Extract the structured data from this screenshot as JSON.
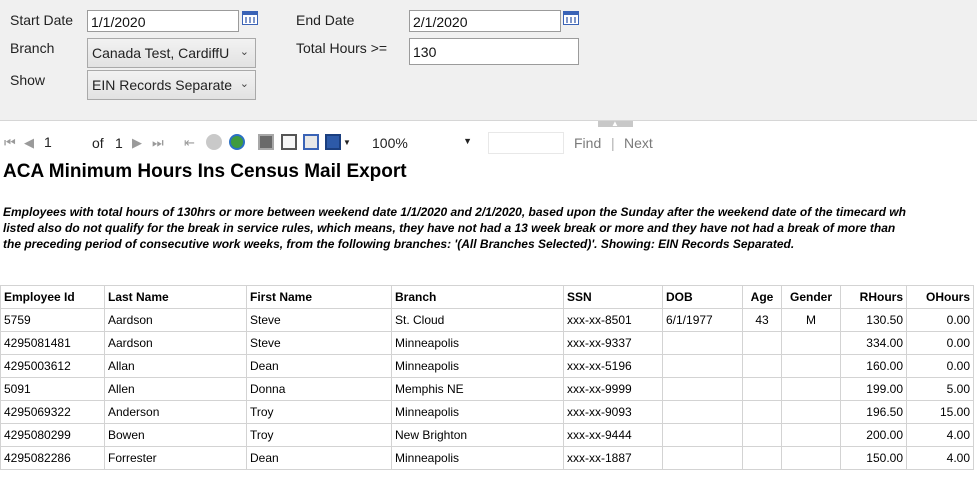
{
  "params": {
    "start_date_label": "Start Date",
    "start_date_value": "1/1/2020",
    "end_date_label": "End Date",
    "end_date_value": "2/1/2020",
    "branch_label": "Branch",
    "branch_value": "Canada Test, CardiffU",
    "total_hours_label": "Total Hours >=",
    "total_hours_value": "130",
    "show_label": "Show",
    "show_value": "EIN Records Separate"
  },
  "toolbar": {
    "page_current": "1",
    "page_of": "of",
    "page_total": "1",
    "zoom": "100%",
    "find_label": "Find",
    "separator": "|",
    "next_label": "Next"
  },
  "report": {
    "title": "ACA Minimum Hours Ins Census Mail Export",
    "description_lines": [
      "Employees with total hours of 130hrs or more between weekend date 1/1/2020 and 2/1/2020, based upon the Sunday after the weekend date of the timecard wh",
      "listed also do not qualify for the break in service rules, which means, they have not had a 13 week break or more and they have not had a break of more than",
      "the preceding period of consecutive work weeks, from the following branches: '(All Branches Selected)'.    Showing: EIN Records Separated."
    ],
    "columns": [
      "Employee Id",
      "Last Name",
      "First Name",
      "Branch",
      "SSN",
      "DOB",
      "Age",
      "Gender",
      "RHours",
      "OHours"
    ],
    "rows": [
      [
        "5759",
        "Aardson",
        "Steve",
        "St. Cloud",
        "xxx-xx-8501",
        "6/1/1977",
        "43",
        "M",
        "130.50",
        "0.00"
      ],
      [
        "4295081481",
        "Aardson",
        "Steve",
        "Minneapolis",
        "xxx-xx-9337",
        "",
        "",
        "",
        "334.00",
        "0.00"
      ],
      [
        "4295003612",
        "Allan",
        "Dean",
        "Minneapolis",
        "xxx-xx-5196",
        "",
        "",
        "",
        "160.00",
        "0.00"
      ],
      [
        "5091",
        "Allen",
        "Donna",
        "Memphis NE",
        "xxx-xx-9999",
        "",
        "",
        "",
        "199.00",
        "5.00"
      ],
      [
        "4295069322",
        "Anderson",
        "Troy",
        "Minneapolis",
        "xxx-xx-9093",
        "",
        "",
        "",
        "196.50",
        "15.00"
      ],
      [
        "4295080299",
        "Bowen",
        "Troy",
        "New Brighton",
        "xxx-xx-9444",
        "",
        "",
        "",
        "200.00",
        "4.00"
      ],
      [
        "4295082286",
        "Forrester",
        "Dean",
        "Minneapolis",
        "xxx-xx-1887",
        "",
        "",
        "",
        "150.00",
        "4.00"
      ]
    ]
  }
}
